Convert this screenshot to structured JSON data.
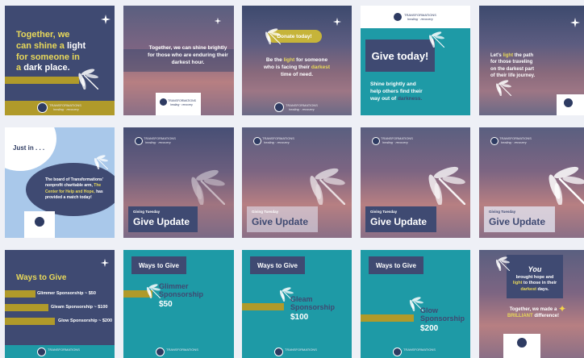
{
  "brand": {
    "name": "TRANSFORMATIONS",
    "tagline": "healing · recovery"
  },
  "colors": {
    "navy": "#3f4a72",
    "teal": "#1e9aa6",
    "gold": "#b09a2a",
    "yellow": "#e8d85a"
  },
  "tiles": {
    "t1": {
      "line1": "Together, we",
      "line2a": "can shine a ",
      "line2b": "light",
      "line3": "for someone in",
      "line4a": "a ",
      "line4b": "dark place."
    },
    "t2": {
      "text": "Together, we can shine brightly for those who are enduring their darkest hour."
    },
    "t3": {
      "button": "Donate today!",
      "p1": "Be the ",
      "p1b": "light",
      "p1c": " for someone",
      "p2a": "who is facing their ",
      "p2b": "darkest",
      "p3": "time of need."
    },
    "t4": {
      "headline": "Give today!",
      "b1": "Shine brightly and",
      "b2": "help others find their",
      "b3a": "way out of ",
      "b3b": "darkness."
    },
    "t5": {
      "l1a": "Let's ",
      "l1b": "light",
      "l1c": " the path",
      "l2": "for those traveling",
      "l3": "on the darkest part",
      "l4": "of their life journey."
    },
    "t6": {
      "justin": "Just in . . .",
      "p1": "The board of Transformations'",
      "p2": "nonprofit charitable arm, ",
      "p2b": "The",
      "p3": "Center for Help and Hope,",
      "p3b": " has",
      "p4": "provided a match today!"
    },
    "t7": {
      "kicker": "Giving Tuesday",
      "headline": "Give Update"
    },
    "t8": {
      "kicker": "Giving Tuesday",
      "headline": "Give Update"
    },
    "t9": {
      "kicker": "Giving Tuesday",
      "headline": "Give Update"
    },
    "t10": {
      "kicker": "Giving Tuesday",
      "headline": "Give Update"
    },
    "t11": {
      "title": "Ways to Give",
      "s1": "Glimmer Sponsorship ~ $50",
      "s2": "Gleam Sponsorship ~ $100",
      "s3": "Glow Sponsorship ~ $200"
    },
    "t12": {
      "title": "Ways to Give",
      "name1": "Glimmer",
      "name2": "Sponsorship",
      "amount": "$50"
    },
    "t13": {
      "title": "Ways to Give",
      "name1": "Gleam",
      "name2": "Sponsorship",
      "amount": "$100"
    },
    "t14": {
      "title": "Ways to Give",
      "name1": "Glow",
      "name2": "Sponsorship",
      "amount": "$200"
    },
    "t15": {
      "you": "You",
      "l1": "brought hope and",
      "l2a": "light",
      "l2b": " to those in their",
      "l3a": "darkest",
      "l3b": " days.",
      "l4": "Together, we made a",
      "l5a": "BRILLIANT",
      "l5b": " difference!"
    }
  }
}
